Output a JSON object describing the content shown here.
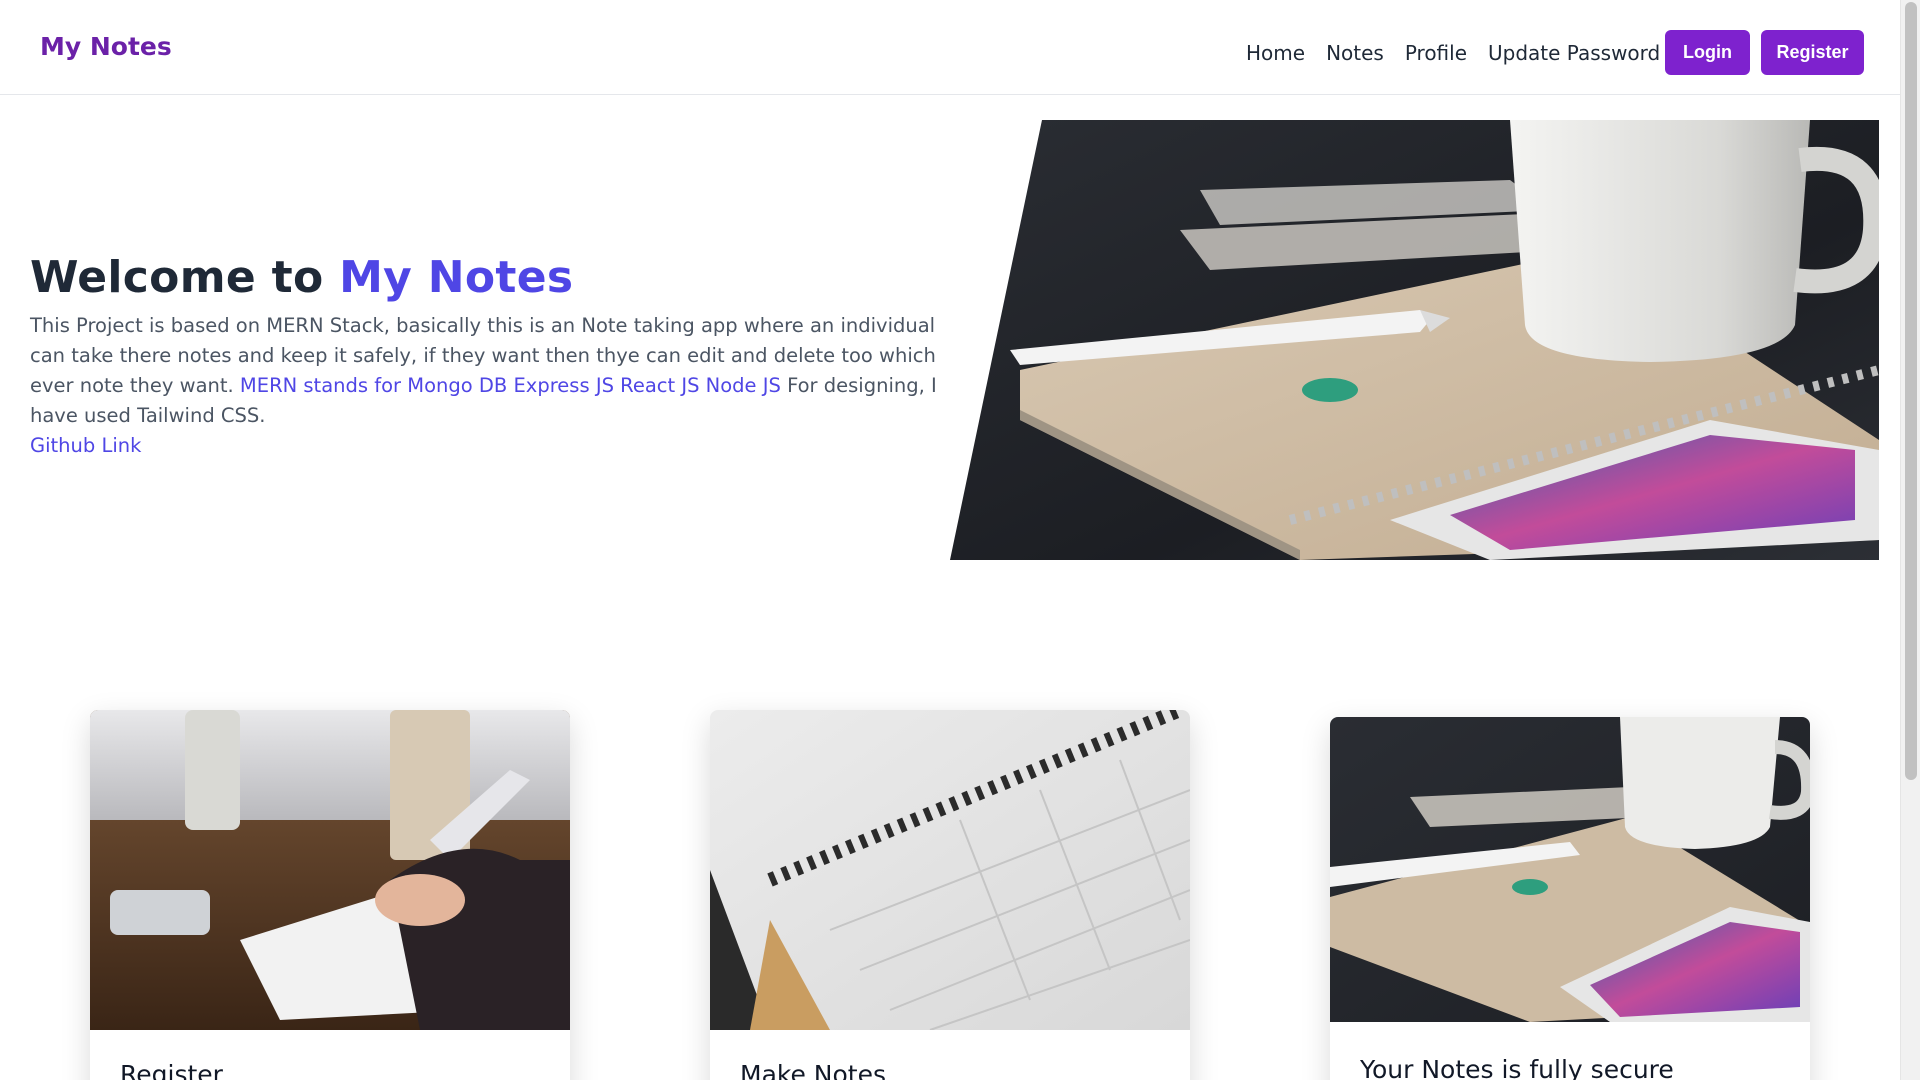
{
  "header": {
    "brand": "My Notes",
    "nav": [
      "Home",
      "Notes",
      "Profile",
      "Update Password"
    ],
    "login_label": "Login",
    "register_label": "Register"
  },
  "hero": {
    "title_prefix": "Welcome to ",
    "title_accent": "My Notes",
    "paragraph_part1": "This Project is based on MERN Stack, basically this is an Note taking app where an individual can take there notes and keep it safely, if they want then thye can edit and delete too which ever note they want. ",
    "mern_link": "MERN stands for Mongo DB Express JS React JS Node JS",
    "paragraph_part2": " For designing, I have used Tailwind CSS. ",
    "github_link": "Github Link"
  },
  "cards": [
    {
      "title": "Register"
    },
    {
      "title": "Make Notes"
    },
    {
      "title": "Your Notes is fully secure"
    }
  ],
  "colors": {
    "brand": "#6b21a8",
    "button": "#7e22ce",
    "accent": "#4f46e5"
  }
}
